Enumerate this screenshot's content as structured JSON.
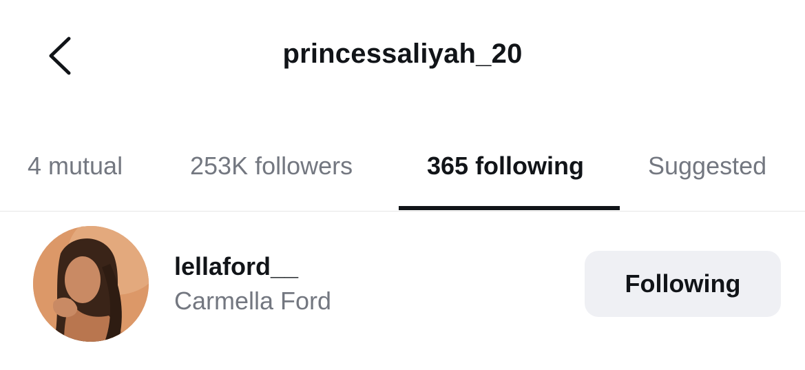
{
  "header": {
    "title": "princessaliyah_20",
    "back_icon": "chevron-left-icon"
  },
  "tabs": [
    {
      "label": "4 mutual",
      "active": false
    },
    {
      "label": "253K followers",
      "active": false
    },
    {
      "label": "365 following",
      "active": true
    },
    {
      "label": "Suggested",
      "active": false
    }
  ],
  "list": [
    {
      "username": "lellaford__",
      "full_name": "Carmella Ford",
      "action_label": "Following"
    }
  ],
  "colors": {
    "text_primary": "#111418",
    "text_secondary": "#737780",
    "button_bg": "#eff0f4",
    "divider": "#e6e6e6"
  }
}
